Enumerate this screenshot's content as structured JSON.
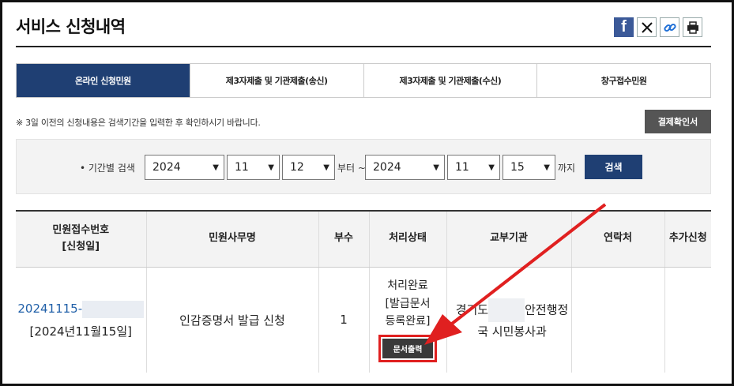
{
  "page": {
    "title": "서비스 신청내역"
  },
  "share": {
    "facebook": "f",
    "twitter": "X",
    "link": "link",
    "print": "print"
  },
  "tabs": [
    {
      "label": "온라인 신청민원",
      "active": true
    },
    {
      "label": "제3자제출 및 기관제출(송신)",
      "active": false
    },
    {
      "label": "제3자제출 및 기관제출(수신)",
      "active": false
    },
    {
      "label": "창구접수민원",
      "active": false
    }
  ],
  "notice": "※ 3일 이전의 신청내용은 검색기간을 입력한 후 확인하시기 바랍니다.",
  "receipt_button": "결제확인서",
  "search": {
    "label": "• 기간별 검색",
    "from_year": "2024",
    "from_month": "11",
    "from_day": "12",
    "from_text": "부터 ~",
    "to_year": "2024",
    "to_month": "11",
    "to_day": "15",
    "to_text": "까지",
    "button": "검색"
  },
  "table": {
    "headers": {
      "receipt_no_line1": "민원접수번호",
      "receipt_no_line2": "[신청일]",
      "service": "민원사무명",
      "copies": "부수",
      "status": "처리상태",
      "agency": "교부기관",
      "contact": "연락처",
      "additional": "추가신청"
    },
    "rows": [
      {
        "receipt_no": "20241115-",
        "date": "[2024년11월15일]",
        "service": "인감증명서 발급 신청",
        "copies": "1",
        "status_line1": "처리완료",
        "status_line2": "[발급문서",
        "status_line3": "등록완료]",
        "print_button": "문서출력",
        "agency_part1": "경기도",
        "agency_part2": "안전행정",
        "agency_part3": "국 시민봉사과",
        "contact": "",
        "additional": ""
      }
    ]
  },
  "colors": {
    "primary": "#1f3f73",
    "highlight": "#e02020"
  }
}
